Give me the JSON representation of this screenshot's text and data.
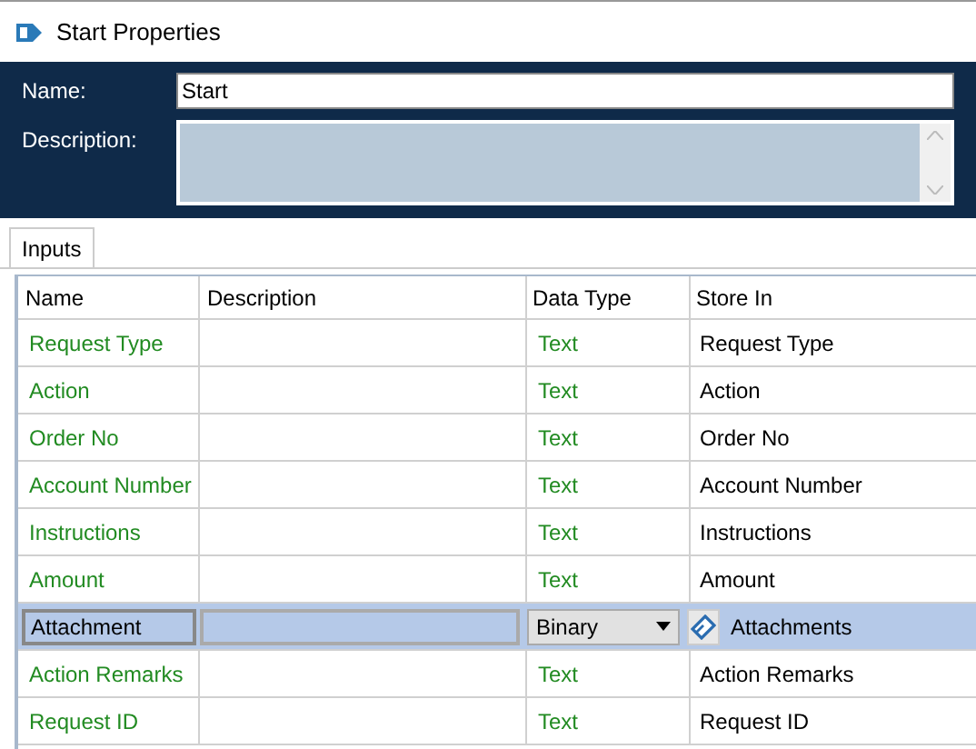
{
  "window": {
    "title": "Start Properties"
  },
  "form": {
    "name_label": "Name:",
    "name_value": "Start",
    "description_label": "Description:"
  },
  "tabs": [
    {
      "label": "Inputs",
      "selected": true
    }
  ],
  "table": {
    "columns": [
      "Name",
      "Description",
      "Data Type",
      "Store In"
    ],
    "rows": [
      {
        "name": "Request Type",
        "data_type": "Text",
        "store_in": "Request Type",
        "selected": false
      },
      {
        "name": "Action",
        "data_type": "Text",
        "store_in": "Action",
        "selected": false
      },
      {
        "name": "Order No",
        "data_type": "Text",
        "store_in": "Order No",
        "selected": false
      },
      {
        "name": "Account Number",
        "data_type": "Text",
        "store_in": "Account Number",
        "selected": false
      },
      {
        "name": "Instructions",
        "data_type": "Text",
        "store_in": "Instructions",
        "selected": false
      },
      {
        "name": "Amount",
        "data_type": "Text",
        "store_in": "Amount",
        "selected": false
      },
      {
        "name": "Attachment",
        "data_type": "Binary",
        "store_in": "Attachments",
        "selected": true
      },
      {
        "name": "Action Remarks",
        "data_type": "Text",
        "store_in": "Action Remarks",
        "selected": false
      },
      {
        "name": "Request ID",
        "data_type": "Text",
        "store_in": "Request ID",
        "selected": false
      }
    ]
  }
}
